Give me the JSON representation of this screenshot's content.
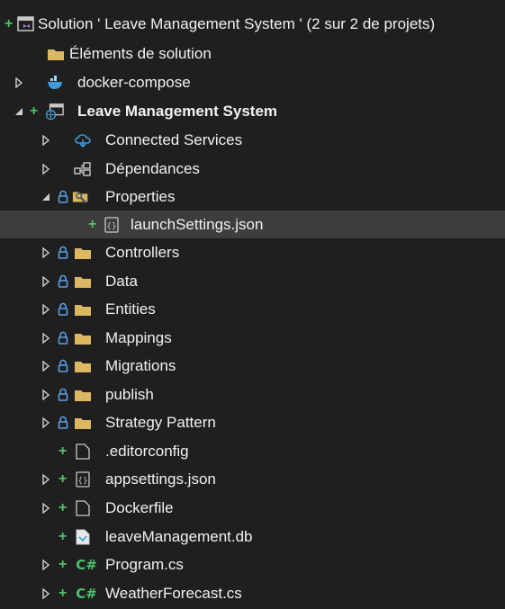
{
  "solution_explorer": {
    "solution_label": "Solution ' Leave Management System ' (2 sur 2 de projets)",
    "solution_items_label": "Éléments de solution",
    "docker_compose_label": "docker-compose",
    "project_label": "Leave Management System",
    "connected_services_label": "Connected Services",
    "dependencies_label": "Dépendances",
    "properties_label": "Properties",
    "launch_settings_label": "launchSettings.json",
    "folders": {
      "controllers": "Controllers",
      "data": "Data",
      "entities": "Entities",
      "mappings": "Mappings",
      "migrations": "Migrations",
      "publish": "publish",
      "strategy_pattern": "Strategy Pattern"
    },
    "editorconfig_label": ".editorconfig",
    "appsettings_label": "appsettings.json",
    "dockerfile_label": "Dockerfile",
    "db_label": "leaveManagement.db",
    "program_label": "Program.cs",
    "weather_label": "WeatherForecast.cs",
    "plus_glyph": "+",
    "cs_glyph": "C#",
    "colors": {
      "background": "#1f1f1f",
      "selected_row": "#3d3d3d",
      "added_green": "#4ec26b",
      "folder_yellow": "#dcb862",
      "lock_blue": "#5aa0e6",
      "text": "#f1f1f1"
    }
  }
}
